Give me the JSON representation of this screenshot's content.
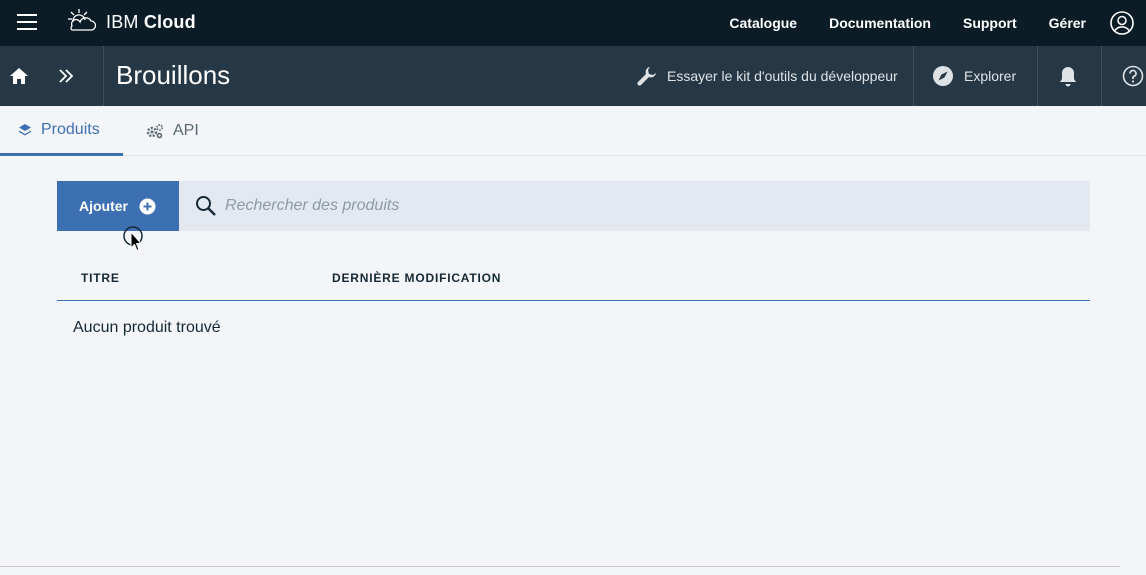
{
  "header": {
    "brand_prefix": "IBM",
    "brand_name": "Cloud",
    "nav": [
      "Catalogue",
      "Documentation",
      "Support",
      "Gérer"
    ]
  },
  "subheader": {
    "title": "Brouillons",
    "toolkit_label": "Essayer le kit d'outils du développeur",
    "explore_label": "Explorer"
  },
  "tabs": [
    {
      "label": "Produits",
      "active": true
    },
    {
      "label": "API",
      "active": false
    }
  ],
  "toolbar": {
    "add_label": "Ajouter",
    "search_placeholder": "Rechercher des produits",
    "search_value": ""
  },
  "table": {
    "columns": [
      "TITRE",
      "DERNIÈRE MODIFICATION"
    ],
    "empty_message": "Aucun produit trouvé"
  },
  "colors": {
    "topbar": "#0b1c27",
    "subbar": "#263845",
    "accent": "#3d70b2",
    "search_bg": "#e3e8f1"
  }
}
